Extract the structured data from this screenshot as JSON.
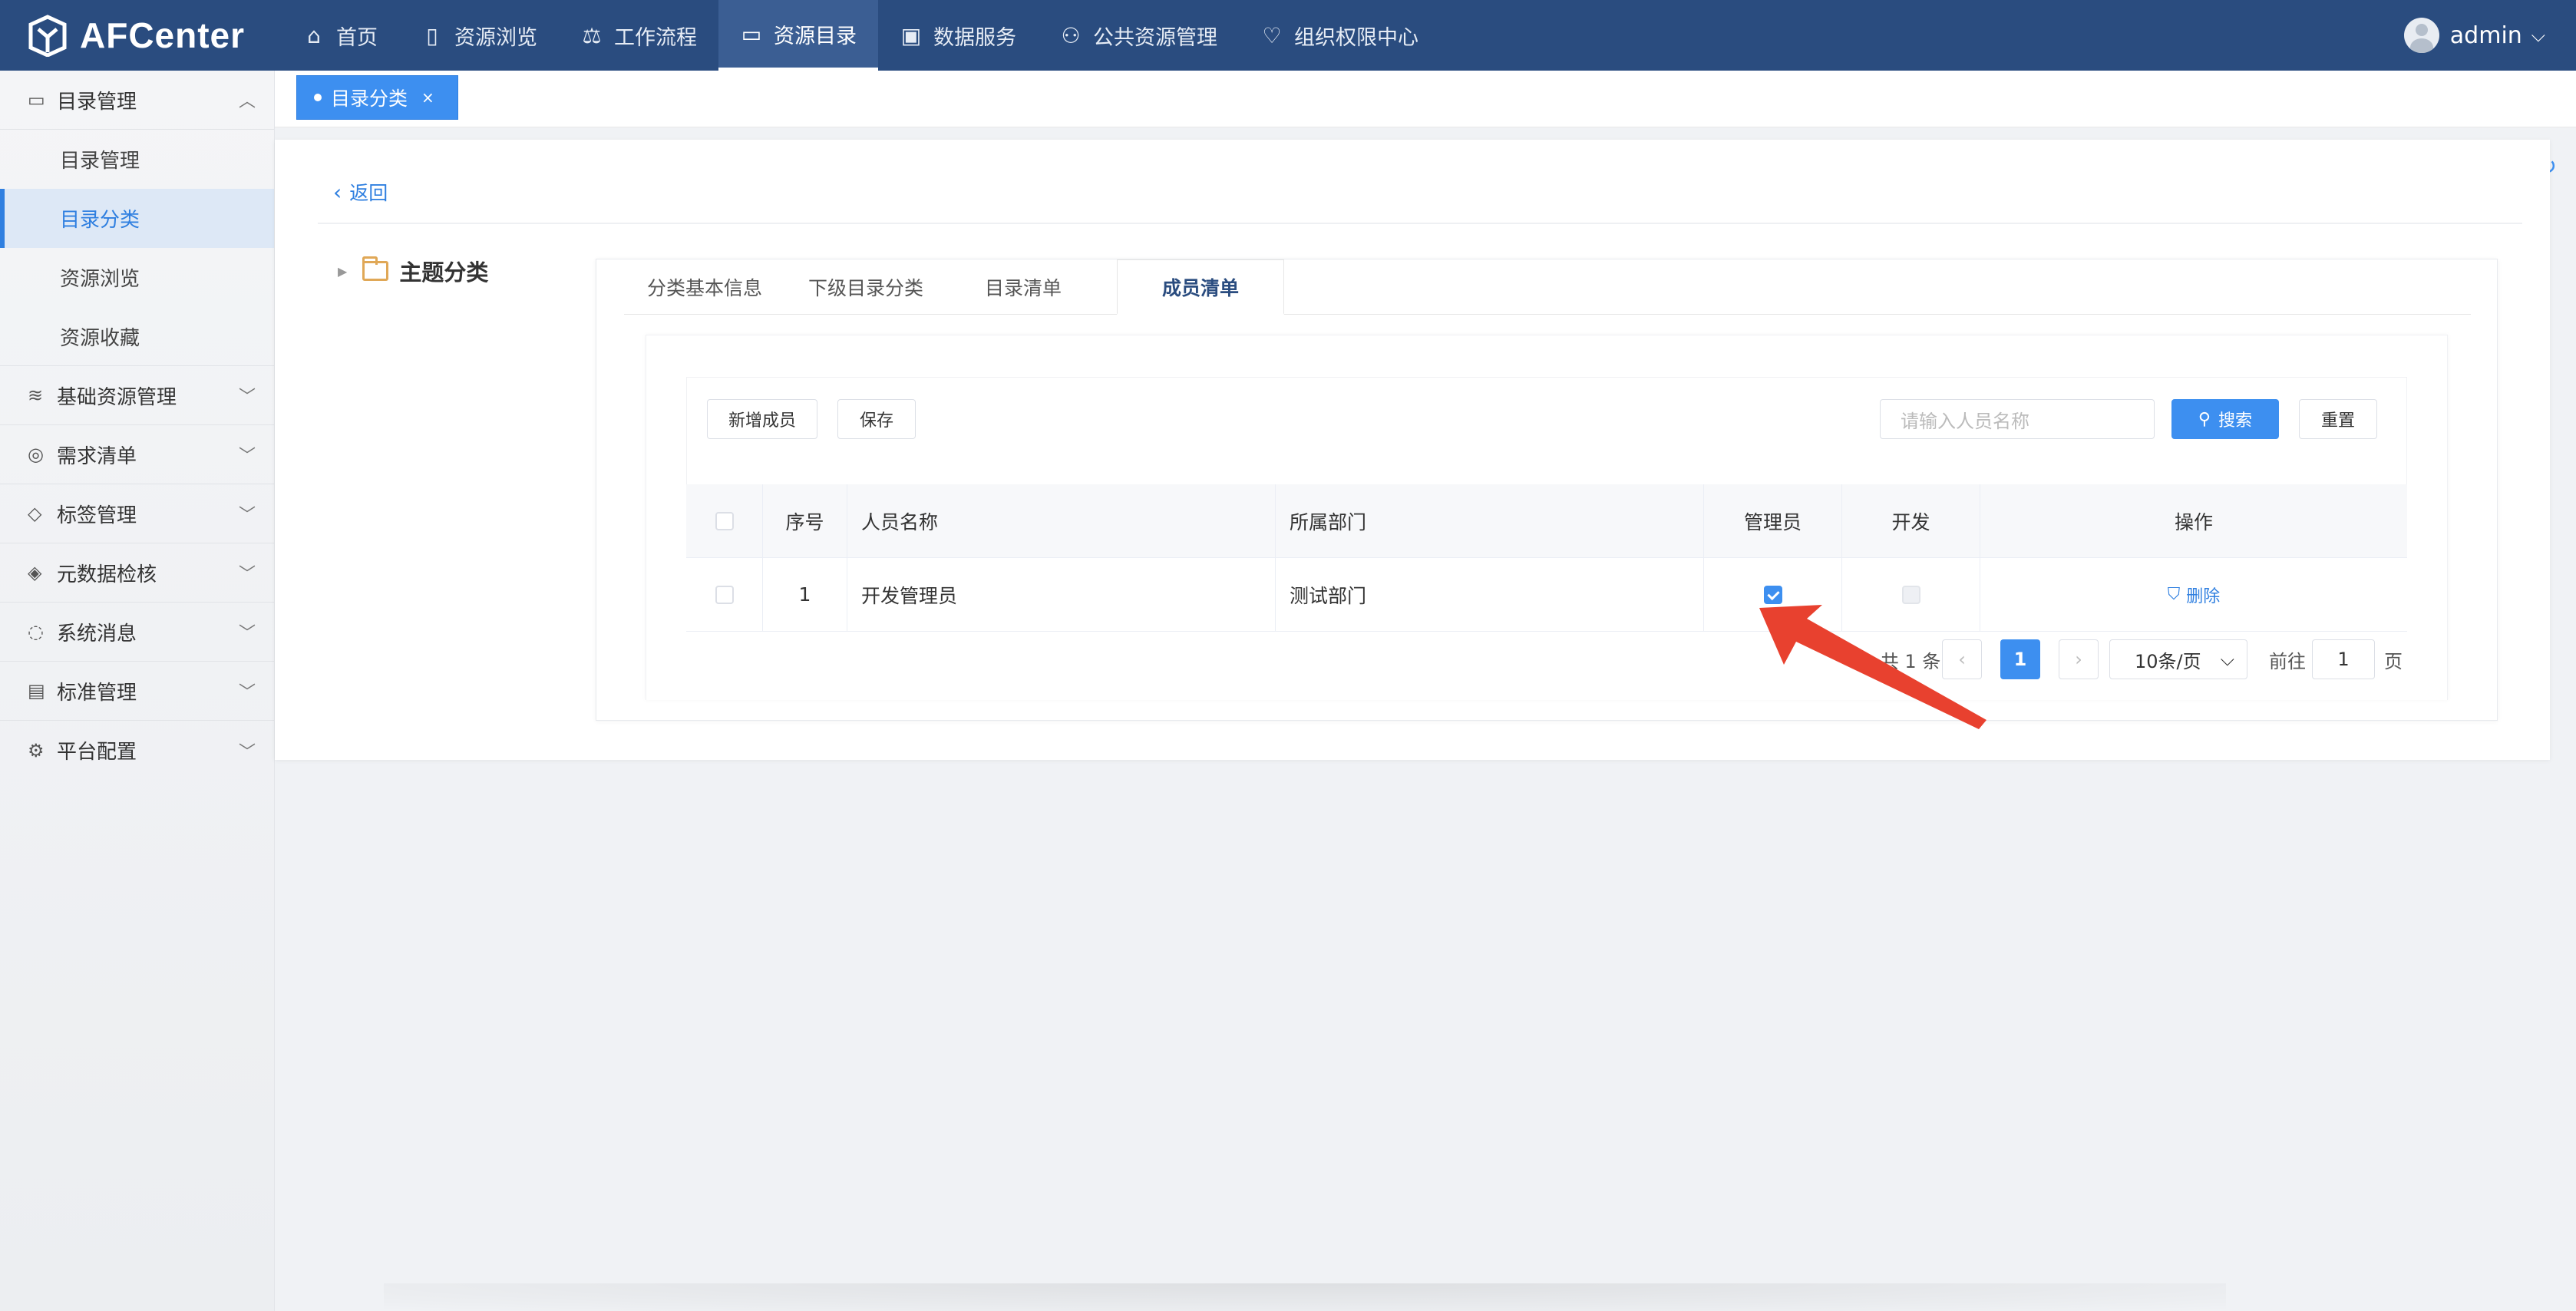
{
  "app": {
    "name": "AFCenter"
  },
  "topnav": [
    {
      "label": "首页",
      "icon": "home-icon",
      "glyph": "⌂"
    },
    {
      "label": "资源浏览",
      "icon": "book-icon",
      "glyph": "▯"
    },
    {
      "label": "工作流程",
      "icon": "scale-icon",
      "glyph": "⚖"
    },
    {
      "label": "资源目录",
      "icon": "folder-icon",
      "glyph": "▭"
    },
    {
      "label": "数据服务",
      "icon": "box-icon",
      "glyph": "▣"
    },
    {
      "label": "公共资源管理",
      "icon": "handshake-icon",
      "glyph": "⚇"
    },
    {
      "label": "组织权限中心",
      "icon": "heart-icon",
      "glyph": "♡"
    }
  ],
  "user": {
    "name": "admin"
  },
  "sidebar": {
    "group1": "目录管理",
    "subitems": [
      "目录管理",
      "目录分类",
      "资源浏览",
      "资源收藏"
    ],
    "groups": [
      {
        "label": "基础资源管理",
        "glyph": "≋"
      },
      {
        "label": "需求清单",
        "glyph": "◎"
      },
      {
        "label": "标签管理",
        "glyph": "◇"
      },
      {
        "label": "元数据检核",
        "glyph": "◈"
      },
      {
        "label": "系统消息",
        "glyph": "◌"
      },
      {
        "label": "标准管理",
        "glyph": "▤"
      },
      {
        "label": "平台配置",
        "glyph": "⚙"
      }
    ]
  },
  "tag": {
    "label": "目录分类",
    "close": "×"
  },
  "page": {
    "back": "返回",
    "tree_root": "主题分类",
    "tabs": [
      "分类基本信息",
      "下级目录分类",
      "目录清单",
      "成员清单"
    ],
    "add_member": "新增成员",
    "save": "保存",
    "search_placeholder": "请输入人员名称",
    "search": "搜索",
    "reset": "重置"
  },
  "table": {
    "columns": [
      "序号",
      "人员名称",
      "所属部门",
      "管理员",
      "开发",
      "操作"
    ],
    "rows": [
      {
        "index": "1",
        "name": "开发管理员",
        "dept": "测试部门",
        "admin": true,
        "dev": false,
        "action": "删除"
      }
    ]
  },
  "pager": {
    "total": "共 1 条",
    "current": "1",
    "page_size": "10条/页",
    "goto": "前往",
    "goto_value": "1",
    "page_unit": "页"
  },
  "colors": {
    "topbar": "#2a4c7f",
    "accent": "#3d8ff0",
    "annotation": "#e8412f"
  }
}
